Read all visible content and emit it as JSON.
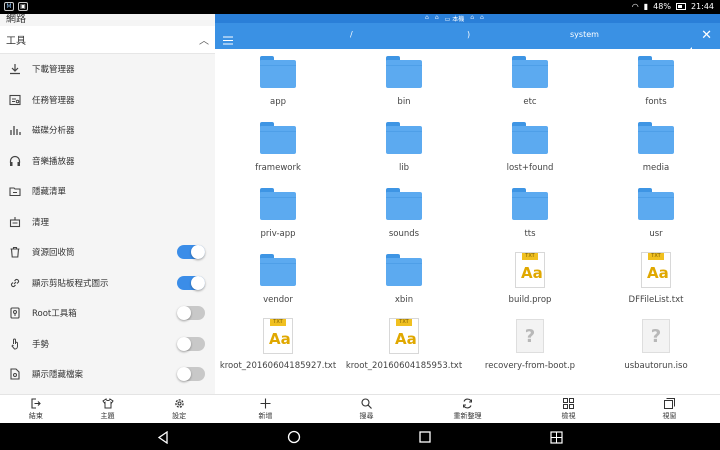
{
  "status_bar": {
    "battery": "48%",
    "time": "21:44"
  },
  "left_panel": {
    "top_label": "網路",
    "section_title": "工具",
    "items": [
      {
        "label": "下載管理器",
        "icon": "download-icon"
      },
      {
        "label": "任務管理器",
        "icon": "task-manager-icon"
      },
      {
        "label": "磁碟分析器",
        "icon": "disk-analyzer-icon"
      },
      {
        "label": "音樂播放器",
        "icon": "headphones-icon"
      },
      {
        "label": "隱藏清單",
        "icon": "hidden-list-icon"
      },
      {
        "label": "清理",
        "icon": "cleaner-icon"
      },
      {
        "label": "資源回收筒",
        "icon": "trash-icon",
        "toggle": true
      },
      {
        "label": "顯示剪貼板程式圖示",
        "icon": "link-icon",
        "toggle": true
      },
      {
        "label": "Root工具箱",
        "icon": "root-toolbox-icon",
        "toggle": false
      },
      {
        "label": "手勢",
        "icon": "gesture-icon",
        "toggle": false
      },
      {
        "label": "顯示隱藏檔案",
        "icon": "hidden-file-icon",
        "toggle": false
      }
    ],
    "bottom": [
      {
        "label": "結束",
        "icon": "exit-icon"
      },
      {
        "label": "主題",
        "icon": "theme-icon"
      },
      {
        "label": "設定",
        "icon": "settings-icon"
      }
    ]
  },
  "right_panel": {
    "tabs_label": "本機",
    "path": [
      "/",
      ")",
      "system"
    ],
    "files": [
      {
        "name": "app",
        "type": "folder"
      },
      {
        "name": "bin",
        "type": "folder"
      },
      {
        "name": "etc",
        "type": "folder"
      },
      {
        "name": "fonts",
        "type": "folder"
      },
      {
        "name": "framework",
        "type": "folder"
      },
      {
        "name": "lib",
        "type": "folder"
      },
      {
        "name": "lost+found",
        "type": "folder"
      },
      {
        "name": "media",
        "type": "folder"
      },
      {
        "name": "priv-app",
        "type": "folder"
      },
      {
        "name": "sounds",
        "type": "folder"
      },
      {
        "name": "tts",
        "type": "folder"
      },
      {
        "name": "usr",
        "type": "folder"
      },
      {
        "name": "vendor",
        "type": "folder"
      },
      {
        "name": "xbin",
        "type": "folder"
      },
      {
        "name": "build.prop",
        "type": "txt"
      },
      {
        "name": "DFFileList.txt",
        "type": "txt"
      },
      {
        "name": "kroot_20160604185927.txt",
        "type": "txt"
      },
      {
        "name": "kroot_20160604185953.txt",
        "type": "txt"
      },
      {
        "name": "recovery-from-boot.p",
        "type": "unknown"
      },
      {
        "name": "usbautorun.iso",
        "type": "unknown"
      }
    ],
    "txt_badge": "TXT",
    "txt_glyph": "Aa",
    "unknown_glyph": "?",
    "bottom": [
      {
        "label": "新增",
        "icon": "plus-icon"
      },
      {
        "label": "搜尋",
        "icon": "search-icon"
      },
      {
        "label": "重新整理",
        "icon": "refresh-icon"
      },
      {
        "label": "檢視",
        "icon": "view-grid-icon"
      },
      {
        "label": "視窗",
        "icon": "windows-icon"
      }
    ]
  },
  "colors": {
    "accent": "#3a91e4",
    "toggle_on": "#3b8de8",
    "folder": "#5caaf0",
    "txt": "#f0c020"
  }
}
